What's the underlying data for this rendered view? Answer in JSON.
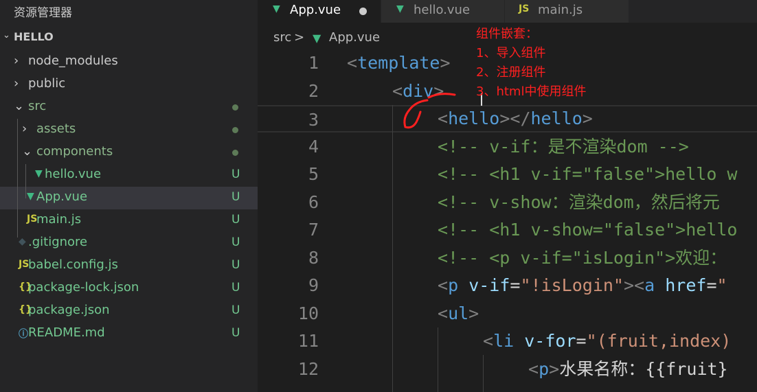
{
  "explorer": {
    "title": "资源管理器",
    "section": "HELLO",
    "tree": [
      {
        "name": "node_modules",
        "kind": "folder",
        "state": "closed",
        "depth": 0,
        "status": ""
      },
      {
        "name": "public",
        "kind": "folder",
        "state": "closed",
        "depth": 0,
        "status": ""
      },
      {
        "name": "src",
        "kind": "folder",
        "state": "open",
        "depth": 0,
        "status": "dot"
      },
      {
        "name": "assets",
        "kind": "folder",
        "state": "closed",
        "depth": 1,
        "status": "dot"
      },
      {
        "name": "components",
        "kind": "folder",
        "state": "open",
        "depth": 1,
        "status": "dot"
      },
      {
        "name": "hello.vue",
        "kind": "vue",
        "depth": 2,
        "status": "U"
      },
      {
        "name": "App.vue",
        "kind": "vue",
        "depth": 1,
        "status": "U",
        "active": true
      },
      {
        "name": "main.js",
        "kind": "js",
        "depth": 1,
        "status": "U"
      },
      {
        "name": ".gitignore",
        "kind": "git",
        "depth": 0,
        "status": "U"
      },
      {
        "name": "babel.config.js",
        "kind": "js",
        "depth": 0,
        "status": "U"
      },
      {
        "name": "package-lock.json",
        "kind": "json",
        "depth": 0,
        "status": "U"
      },
      {
        "name": "package.json",
        "kind": "json",
        "depth": 0,
        "status": "U"
      },
      {
        "name": "README.md",
        "kind": "info",
        "depth": 0,
        "status": "U"
      }
    ]
  },
  "tabs": [
    {
      "label": "App.vue",
      "icon": "vue",
      "active": true,
      "modified": true
    },
    {
      "label": "hello.vue",
      "icon": "vue",
      "active": false,
      "modified": false
    },
    {
      "label": "main.js",
      "icon": "js",
      "active": false,
      "modified": false
    }
  ],
  "breadcrumb": {
    "folder": "src",
    "separator": ">",
    "file": "App.vue"
  },
  "annotation": [
    "组件嵌套：",
    "1、导入组件",
    "2、注册组件",
    "3、html中使用组件"
  ],
  "code": [
    {
      "n": "1",
      "indent": 0,
      "tokens": [
        [
          "punc",
          "<"
        ],
        [
          "tag",
          "template"
        ],
        [
          "punc",
          ">"
        ]
      ]
    },
    {
      "n": "2",
      "indent": 1,
      "tokens": [
        [
          "punc",
          "<"
        ],
        [
          "tag",
          "div"
        ],
        [
          "punc",
          ">"
        ]
      ]
    },
    {
      "n": "3",
      "indent": 2,
      "current": true,
      "tokens": [
        [
          "punc",
          "<"
        ],
        [
          "tag",
          "hello"
        ],
        [
          "punc",
          "><"
        ],
        [
          "punc",
          "/"
        ],
        [
          "tag",
          "hello"
        ],
        [
          "punc",
          ">"
        ]
      ]
    },
    {
      "n": "4",
      "indent": 2,
      "tokens": [
        [
          "com",
          "<!-- v-if：是不渲染dom -->"
        ]
      ]
    },
    {
      "n": "5",
      "indent": 2,
      "tokens": [
        [
          "com",
          "<!-- <h1 v-if=\"false\">hello w"
        ]
      ]
    },
    {
      "n": "6",
      "indent": 2,
      "tokens": [
        [
          "com",
          "<!-- v-show：渲染dom，然后将元"
        ]
      ]
    },
    {
      "n": "7",
      "indent": 2,
      "tokens": [
        [
          "com",
          "<!-- <h1 v-show=\"false\">hello"
        ]
      ]
    },
    {
      "n": "8",
      "indent": 2,
      "tokens": [
        [
          "com",
          "<!-- <p v-if=\"isLogin\">欢迎："
        ]
      ]
    },
    {
      "n": "9",
      "indent": 2,
      "tokens": [
        [
          "punc",
          "<"
        ],
        [
          "tag",
          "p"
        ],
        [
          "text",
          " "
        ],
        [
          "attr",
          "v-if"
        ],
        [
          "text",
          "="
        ],
        [
          "str",
          "\"!isLogin\""
        ],
        [
          "punc",
          ">"
        ],
        [
          "punc",
          "<"
        ],
        [
          "tag",
          "a"
        ],
        [
          "text",
          " "
        ],
        [
          "attr",
          "href"
        ],
        [
          "text",
          "="
        ],
        [
          "str",
          "\""
        ]
      ]
    },
    {
      "n": "10",
      "indent": 2,
      "tokens": [
        [
          "punc",
          "<"
        ],
        [
          "tag",
          "ul"
        ],
        [
          "punc",
          ">"
        ]
      ]
    },
    {
      "n": "11",
      "indent": 3,
      "tokens": [
        [
          "punc",
          "<"
        ],
        [
          "tag",
          "li"
        ],
        [
          "text",
          " "
        ],
        [
          "attr",
          "v-for"
        ],
        [
          "text",
          "="
        ],
        [
          "str",
          "\"(fruit,index)"
        ]
      ]
    },
    {
      "n": "12",
      "indent": 4,
      "tokens": [
        [
          "punc",
          "<"
        ],
        [
          "tag",
          "p"
        ],
        [
          "punc",
          ">"
        ],
        [
          "text",
          "水果名称：{{fruit}"
        ]
      ]
    }
  ]
}
